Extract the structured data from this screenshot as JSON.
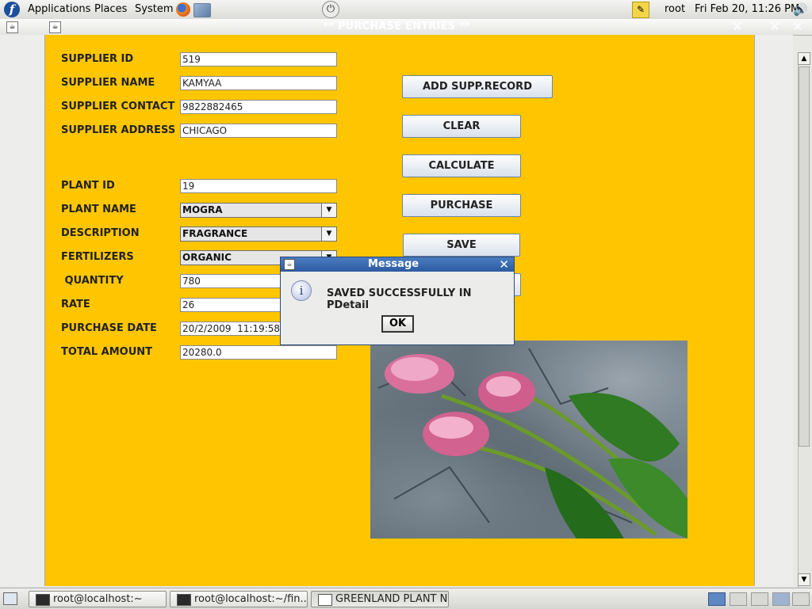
{
  "top_panel": {
    "menus": [
      "Applications",
      "Places",
      "System"
    ],
    "user": "root",
    "clock": "Fri Feb 20, 11:26 PM"
  },
  "window": {
    "title": "** PURCHASE ENTRIES **"
  },
  "form": {
    "supplier_id_label": "SUPPLIER ID",
    "supplier_id_value": "519",
    "supplier_name_label": "SUPPLIER NAME",
    "supplier_name_value": "KAMYAA",
    "supplier_contact_label": "SUPPLIER CONTACT",
    "supplier_contact_value": "9822882465",
    "supplier_address_label": "SUPPLIER ADDRESS",
    "supplier_address_value": "CHICAGO",
    "plant_id_label": "PLANT ID",
    "plant_id_value": "19",
    "plant_name_label": "PLANT NAME",
    "plant_name_value": "MOGRA",
    "description_label": "DESCRIPTION",
    "description_value": "FRAGRANCE",
    "fertilizers_label": "FERTILIZERS",
    "fertilizers_value": "ORGANIC",
    "quantity_label": " QUANTITY",
    "quantity_value": "780",
    "rate_label": "RATE",
    "rate_value": "26",
    "purchase_date_label": "PURCHASE DATE",
    "purchase_date_value": "20/2/2009  11:19:58",
    "total_amount_label": "TOTAL AMOUNT",
    "total_amount_value": "20280.0"
  },
  "buttons": {
    "add_supp_record": "ADD SUPP.RECORD",
    "clear": "CLEAR",
    "calculate": "CALCULATE",
    "purchase": "PURCHASE",
    "save": "SAVE"
  },
  "dialog": {
    "title": "Message",
    "message": "SAVED SUCCESSFULLY IN PDetail",
    "ok": "OK"
  },
  "taskbar": {
    "tasks": [
      "root@localhost:~",
      "root@localhost:~/fin...",
      "GREENLAND PLANT N..."
    ]
  },
  "colors": {
    "content_background": "#ffc600",
    "dialog_titlebar": "#2d5aa0"
  },
  "icons": [
    "fedora-logo-icon",
    "firefox-icon",
    "network-icon",
    "power-icon",
    "notes-icon",
    "volume-icon",
    "info-icon",
    "terminal-icon",
    "java-app-icon"
  ]
}
